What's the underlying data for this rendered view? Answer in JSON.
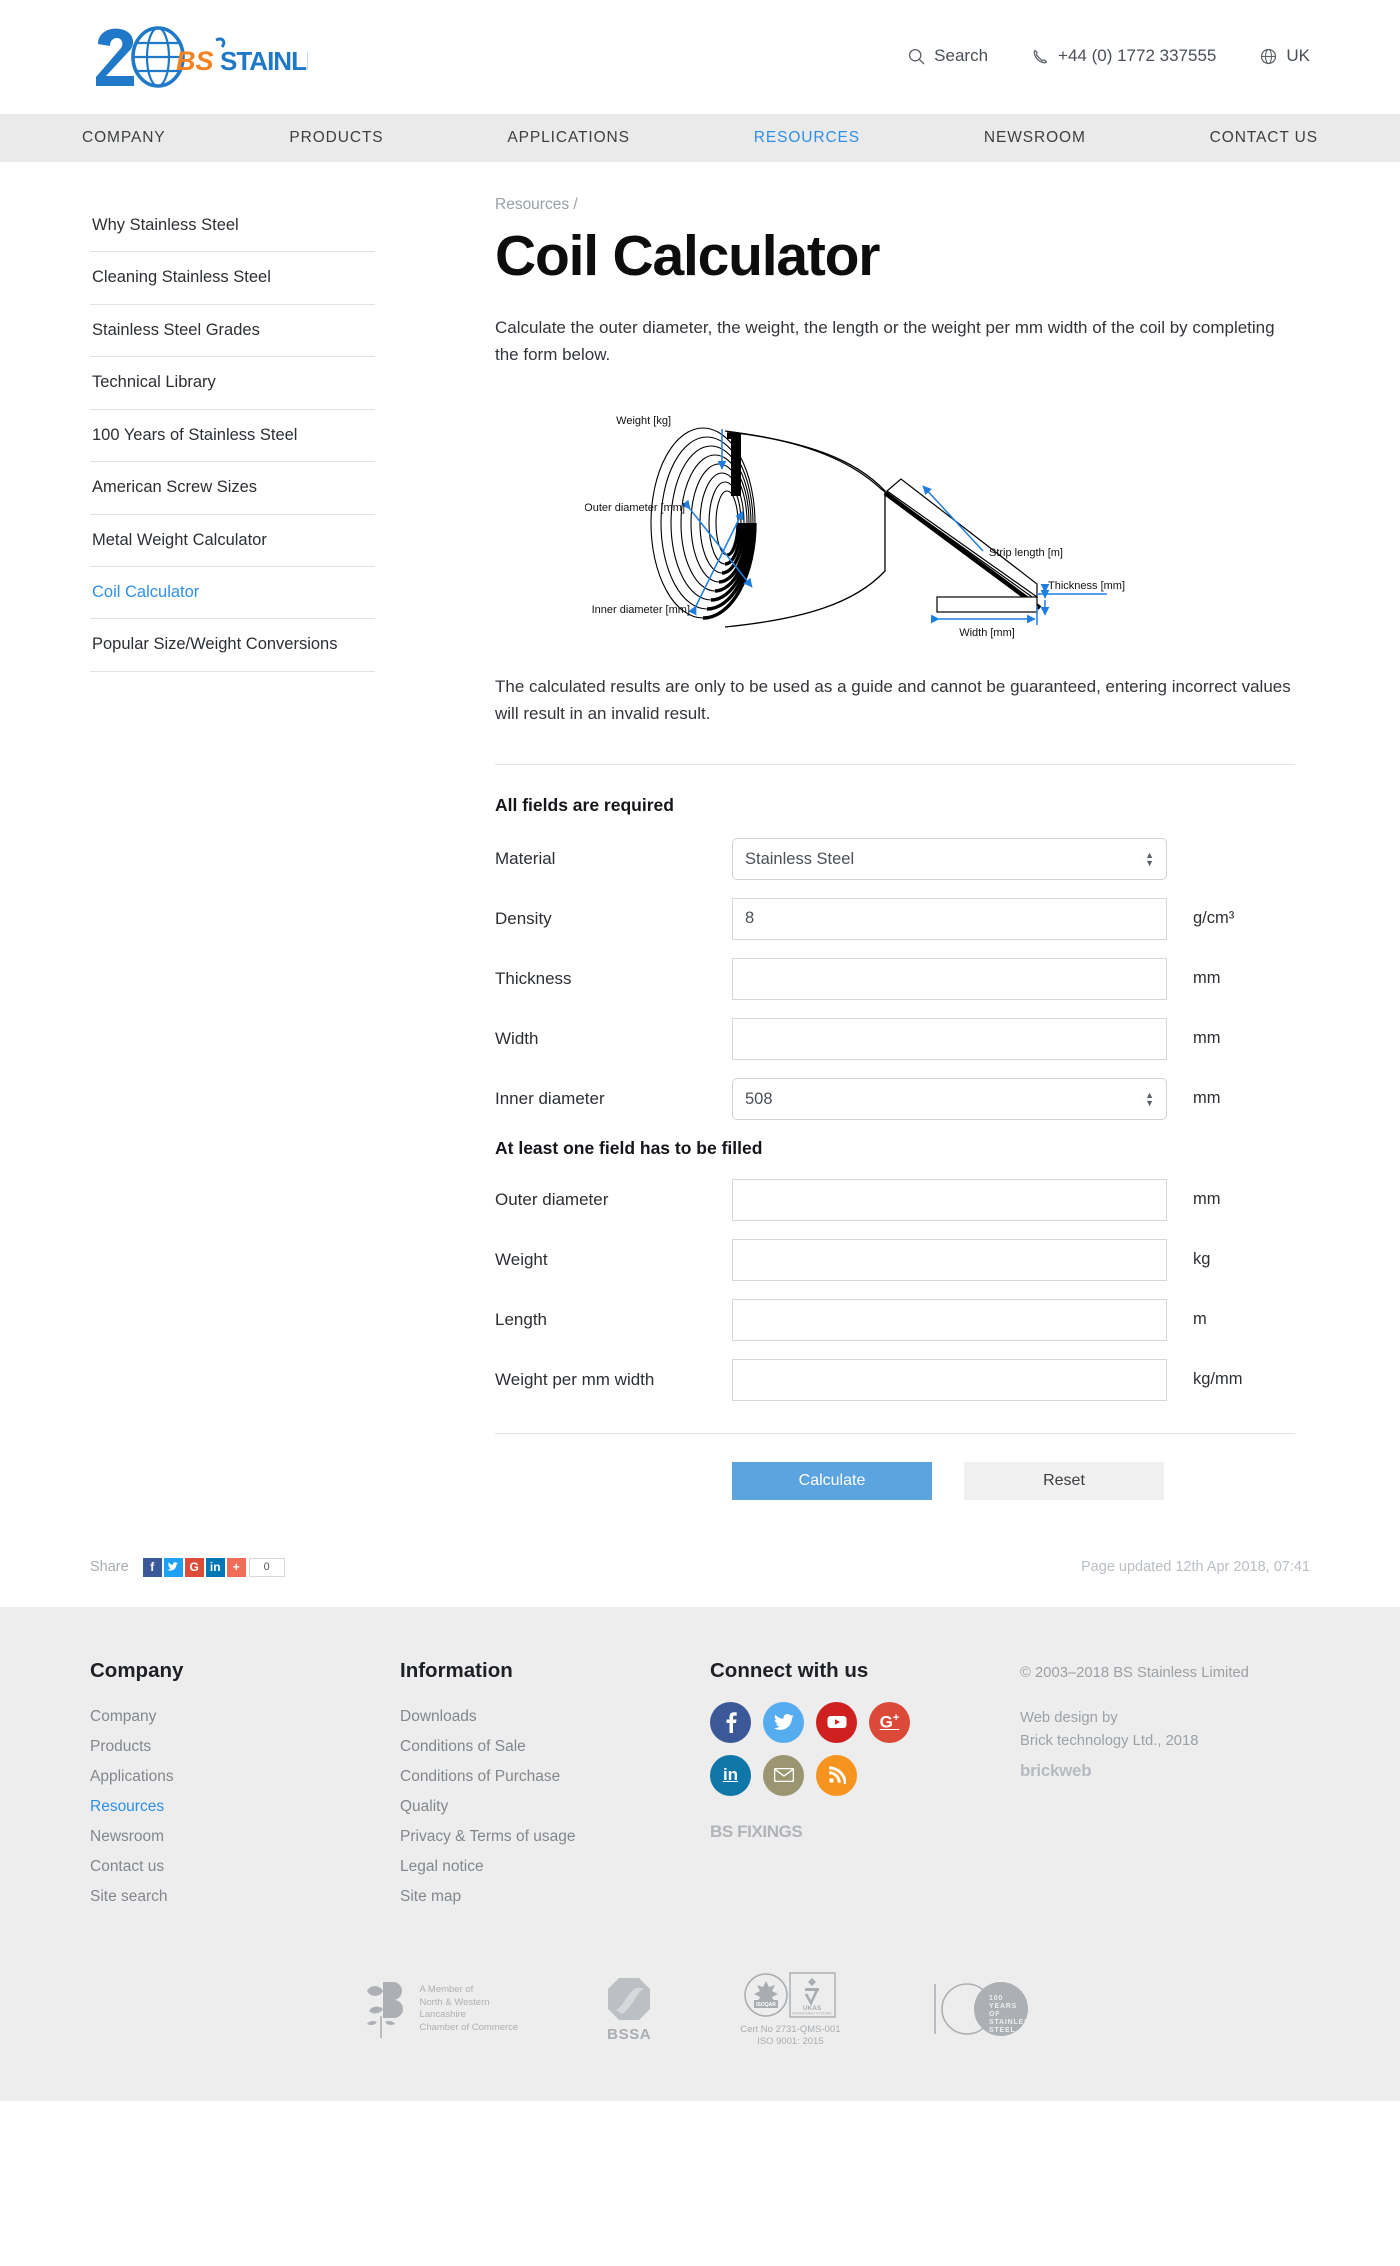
{
  "header": {
    "logo_alt": "20 BS Stainless",
    "logo_number": "20",
    "logo_bs": "BS",
    "logo_word": "STAINLESS",
    "search_label": "Search",
    "phone": "+44 (0) 1772 337555",
    "region": "UK"
  },
  "nav": {
    "items": [
      {
        "label": "COMPANY",
        "active": false
      },
      {
        "label": "PRODUCTS",
        "active": false
      },
      {
        "label": "APPLICATIONS",
        "active": false
      },
      {
        "label": "RESOURCES",
        "active": true
      },
      {
        "label": "NEWSROOM",
        "active": false
      },
      {
        "label": "CONTACT US",
        "active": false
      }
    ]
  },
  "sidebar": {
    "items": [
      {
        "label": "Why Stainless Steel",
        "active": false
      },
      {
        "label": "Cleaning Stainless Steel",
        "active": false
      },
      {
        "label": "Stainless Steel Grades",
        "active": false
      },
      {
        "label": "Technical Library",
        "active": false
      },
      {
        "label": "100 Years of Stainless Steel",
        "active": false
      },
      {
        "label": "American Screw Sizes",
        "active": false
      },
      {
        "label": "Metal Weight Calculator",
        "active": false
      },
      {
        "label": "Coil Calculator",
        "active": true
      },
      {
        "label": "Popular Size/Weight Conversions",
        "active": false
      }
    ]
  },
  "main": {
    "breadcrumb": "Resources",
    "breadcrumb_sep": "/",
    "title": "Coil Calculator",
    "intro": "Calculate the outer diameter, the weight, the length or the weight per mm width of the coil by completing the form below.",
    "disclaimer": "The calculated results are only to be used as a guide and cannot be guaranteed, entering incorrect values will result in an invalid result."
  },
  "diagram": {
    "labels": {
      "weight": "Weight [kg]",
      "outer_diameter": "Outer diameter [mm]",
      "inner_diameter": "Inner diameter [mm]",
      "strip_length": "Strip length [m]",
      "thickness": "Thickness [mm]",
      "width": "Width [mm]"
    },
    "arrow_color": "#1f7ee0"
  },
  "form": {
    "required_heading": "All fields are required",
    "optional_heading": "At least one field has to be filled",
    "required_fields": [
      {
        "label": "Material",
        "type": "select",
        "value": "Stainless Steel",
        "unit": ""
      },
      {
        "label": "Density",
        "type": "text",
        "value": "8",
        "unit": "g/cm³"
      },
      {
        "label": "Thickness",
        "type": "text",
        "value": "",
        "unit": "mm"
      },
      {
        "label": "Width",
        "type": "text",
        "value": "",
        "unit": "mm"
      },
      {
        "label": "Inner diameter",
        "type": "select",
        "value": "508",
        "unit": "mm"
      }
    ],
    "optional_fields": [
      {
        "label": "Outer diameter",
        "type": "text",
        "value": "",
        "unit": "mm"
      },
      {
        "label": "Weight",
        "type": "text",
        "value": "",
        "unit": "kg"
      },
      {
        "label": "Length",
        "type": "text",
        "value": "",
        "unit": "m"
      },
      {
        "label": "Weight per mm width",
        "type": "text",
        "value": "",
        "unit": "kg/mm"
      }
    ],
    "calculate_label": "Calculate",
    "reset_label": "Reset",
    "primary_color": "#5ba4e0"
  },
  "share": {
    "label": "Share",
    "count": "0",
    "buttons": [
      "facebook",
      "twitter",
      "google-plus",
      "linkedin",
      "addthis"
    ],
    "page_updated": "Page updated 12th Apr 2018, 07:41"
  },
  "footer": {
    "company": {
      "heading": "Company",
      "links": [
        {
          "label": "Company",
          "active": false
        },
        {
          "label": "Products",
          "active": false
        },
        {
          "label": "Applications",
          "active": false
        },
        {
          "label": "Resources",
          "active": true
        },
        {
          "label": "Newsroom",
          "active": false
        },
        {
          "label": "Contact us",
          "active": false
        },
        {
          "label": "Site search",
          "active": false
        }
      ]
    },
    "information": {
      "heading": "Information",
      "links": [
        {
          "label": "Downloads"
        },
        {
          "label": "Conditions of Sale"
        },
        {
          "label": "Conditions of Purchase"
        },
        {
          "label": "Quality"
        },
        {
          "label": "Privacy & Terms of usage"
        },
        {
          "label": "Legal notice"
        },
        {
          "label": "Site map"
        }
      ]
    },
    "connect": {
      "heading": "Connect with us",
      "socials": [
        "facebook",
        "twitter",
        "youtube",
        "google-plus",
        "linkedin",
        "email",
        "rss"
      ],
      "bs_fixings": "BS FIXINGS"
    },
    "legal": {
      "copyright": "© 2003–2018  BS Stainless Limited",
      "webdesign_line1": "Web design by",
      "webdesign_line2": "Brick technology Ltd., 2018",
      "brickweb": "brickweb"
    },
    "certifications": [
      {
        "name": "chamber-of-commerce",
        "text_line1": "A Member of",
        "text_line2": "North & Western",
        "text_line3": "Lancashire",
        "text_line4": "Chamber of Commerce"
      },
      {
        "name": "bssa",
        "caption": "BSSA"
      },
      {
        "name": "isoqar-ukas",
        "badge1": "ISOQAR",
        "badge1_sub": "REGISTERED",
        "badge2": "UKAS",
        "badge2_sub1": "MANAGEMENT",
        "badge2_sub2": "SYSTEMS",
        "badge2_num": "0026",
        "caption_line1": "Cert No 2731-QMS-001",
        "caption_line2": "ISO 9001: 2015"
      },
      {
        "name": "100-years-of-stainless-steel",
        "line1": "100",
        "line2": "YEARS",
        "line3": "OF",
        "line4": "STAINLESS",
        "line5": "STEEL"
      }
    ]
  }
}
